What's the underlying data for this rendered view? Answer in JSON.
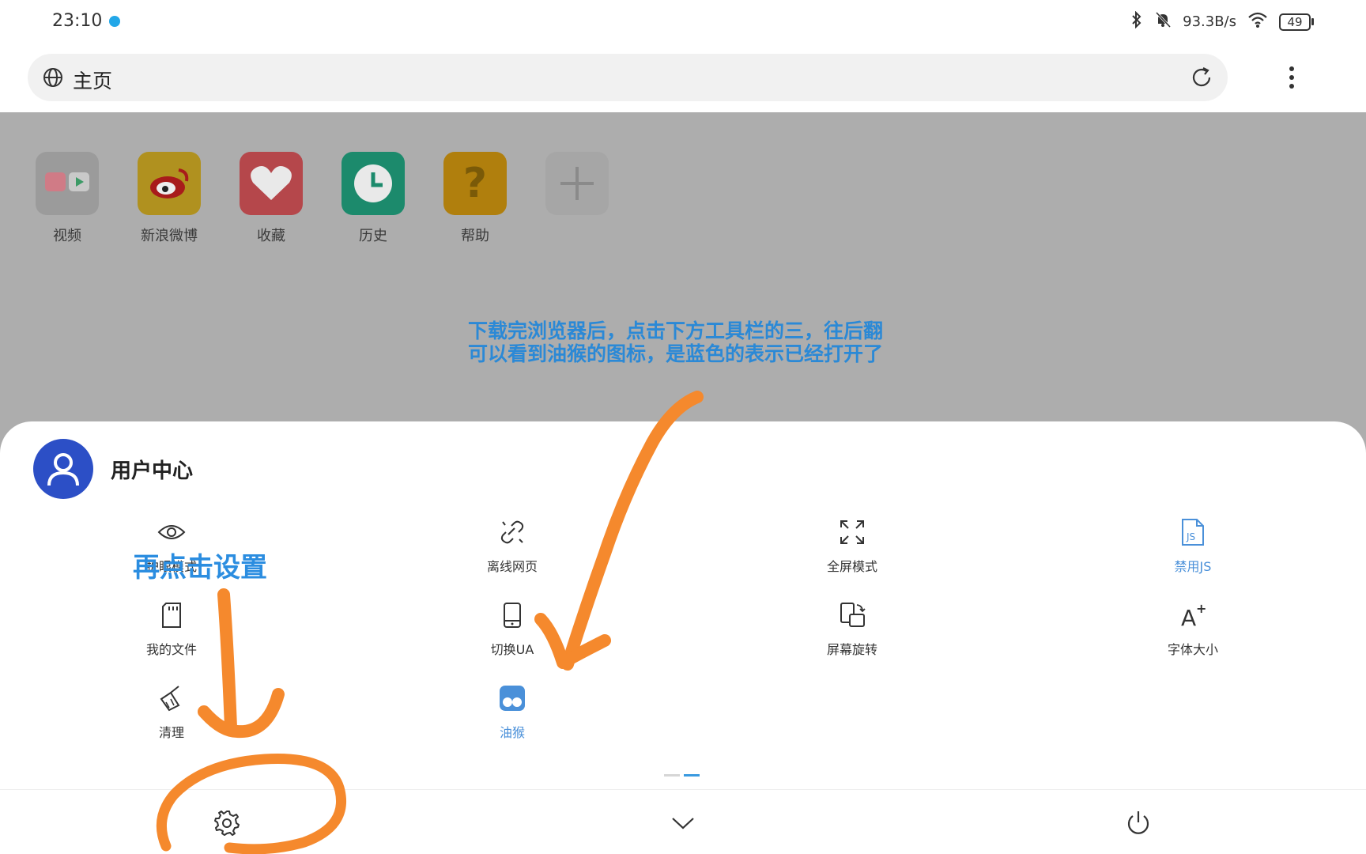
{
  "status_bar": {
    "time": "23:10",
    "network_speed": "93.3B/s",
    "battery": "49"
  },
  "address_bar": {
    "title": "主页"
  },
  "shortcuts": [
    {
      "label": "视频",
      "color": "#9b9b9b"
    },
    {
      "label": "新浪微博",
      "color": "#b0911f"
    },
    {
      "label": "收藏",
      "color": "#b5474b"
    },
    {
      "label": "历史",
      "color": "#1c8a6c"
    },
    {
      "label": "帮助",
      "color": "#b07f0d"
    },
    {
      "label": "",
      "color": "#a6a6a6"
    }
  ],
  "hint": {
    "line1": "下载完浏览器后，点击下方工具栏的三，往后翻",
    "line2": "可以看到油猴的图标，是蓝色的表示已经打开了"
  },
  "user_center": {
    "title": "用户中心"
  },
  "tools": [
    {
      "label": "护眼模式",
      "icon": "eye-icon"
    },
    {
      "label": "离线网页",
      "icon": "offline-link-icon"
    },
    {
      "label": "全屏模式",
      "icon": "fullscreen-icon"
    },
    {
      "label": "禁用JS",
      "icon": "js-file-icon",
      "active": true
    },
    {
      "label": "我的文件",
      "icon": "sd-card-icon"
    },
    {
      "label": "切换UA",
      "icon": "phone-icon"
    },
    {
      "label": "屏幕旋转",
      "icon": "rotate-screen-icon"
    },
    {
      "label": "字体大小",
      "icon": "font-size-icon"
    },
    {
      "label": "清理",
      "icon": "broom-icon"
    },
    {
      "label": "油猴",
      "icon": "tampermonkey-icon",
      "active": true
    }
  ],
  "annotation": {
    "text": "再点击设置"
  },
  "colors": {
    "accent_blue": "#4a90d9",
    "annotation_orange": "#f5892d",
    "avatar_blue": "#2c4fc6"
  }
}
